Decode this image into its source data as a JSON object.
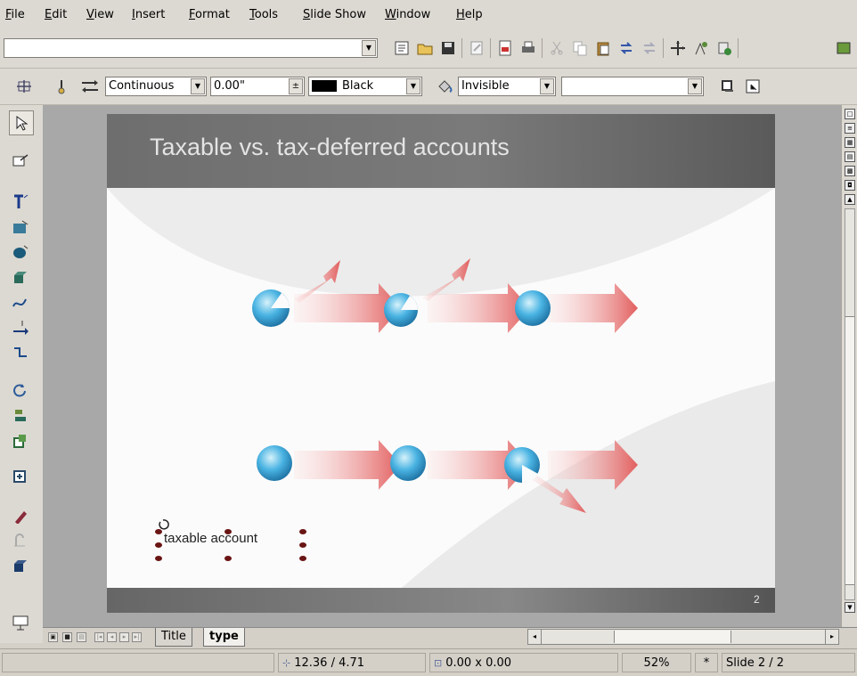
{
  "menu": [
    "File",
    "Edit",
    "View",
    "Insert",
    "Format",
    "Tools",
    "Slide Show",
    "Window",
    "Help"
  ],
  "toolbar_line": {
    "style": "Continuous",
    "width": "0.00\"",
    "color": "Black",
    "area_style": "Invisible",
    "area_fill": ""
  },
  "slide": {
    "title": "Taxable vs. tax-deferred accounts",
    "selected_text": "taxable account",
    "number": "2"
  },
  "tabs": [
    "Title",
    "type"
  ],
  "active_tab": "type",
  "status": {
    "position": "12.36 / 4.71",
    "size": "0.00 x 0.00",
    "zoom": "52%",
    "modified": "*",
    "slide": "Slide 2 / 2"
  },
  "colors": {
    "arrow": "#e57b7b",
    "sphere": "#3ca8d8",
    "header": "#6e6e6e",
    "selection_handle": "#7a1a1a"
  }
}
